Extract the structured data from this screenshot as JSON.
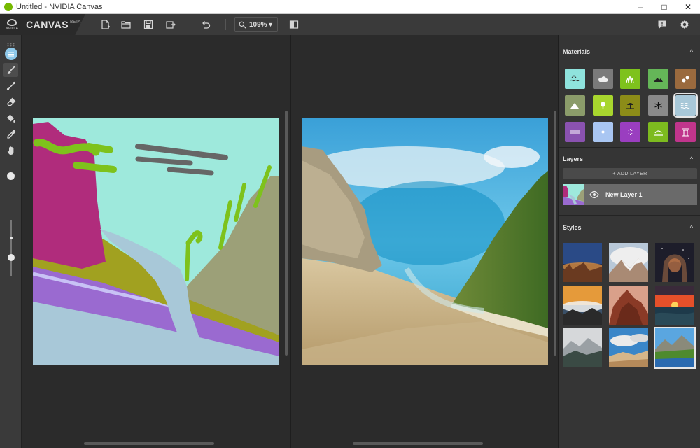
{
  "window": {
    "title": "Untitled - NVIDIA Canvas",
    "min_glyph": "–",
    "max_glyph": "□",
    "close_glyph": "✕"
  },
  "brand": {
    "logo_text": "NVIDIA",
    "name": "CANVAS",
    "badge": "BETA"
  },
  "toolbar": {
    "zoom_value": "109%",
    "zoom_caret": "▼",
    "icons": [
      "new-file-icon",
      "open-folder-icon",
      "save-icon",
      "export-icon",
      "undo-icon",
      "search-icon",
      "split-view-icon",
      "feedback-icon",
      "gear-icon"
    ]
  },
  "tools": [
    "palette-icon",
    "brush-icon",
    "line-icon",
    "eraser-icon",
    "fill-bucket-icon",
    "eyedropper-icon",
    "hand-icon"
  ],
  "brush_size_level": 0.3,
  "colors": {
    "accent": "#76b900",
    "panel_bg": "#353535",
    "toolbar_bg": "#3a3a3a",
    "workspace_bg": "#2b2b2b"
  },
  "panels": {
    "materials": {
      "title": "Materials",
      "chevron": "^",
      "items": [
        {
          "name": "sea",
          "color": "#8fe3dd",
          "selected": false
        },
        {
          "name": "cloud",
          "color": "#7a7a7a",
          "selected": false
        },
        {
          "name": "grass",
          "color": "#7ec21c",
          "selected": false
        },
        {
          "name": "hill",
          "color": "#65b658",
          "selected": false
        },
        {
          "name": "dirt",
          "color": "#9a6a3e",
          "selected": false
        },
        {
          "name": "mountain",
          "color": "#8b9c6a",
          "selected": false
        },
        {
          "name": "tree",
          "color": "#a8d62e",
          "selected": false
        },
        {
          "name": "bush",
          "color": "#8c8c18",
          "selected": false
        },
        {
          "name": "snow",
          "color": "#8a8a8a",
          "selected": false
        },
        {
          "name": "water",
          "color": "#a8c8d8",
          "selected": true
        },
        {
          "name": "rock",
          "color": "#8a52b0",
          "selected": false
        },
        {
          "name": "sky",
          "color": "#a9c6f2",
          "selected": false
        },
        {
          "name": "flower",
          "color": "#9a3ec0",
          "selected": false
        },
        {
          "name": "sand",
          "color": "#7dbb1f",
          "selected": false
        },
        {
          "name": "building",
          "color": "#c0358c",
          "selected": false
        }
      ]
    },
    "layers": {
      "title": "Layers",
      "chevron": "^",
      "add_label": "+ ADD LAYER",
      "items": [
        {
          "name": "New Layer 1"
        }
      ]
    },
    "styles": {
      "title": "Styles",
      "chevron": "^",
      "items": [
        "dusk-desert",
        "snowy-peaks",
        "night-arch",
        "sunset-clouds",
        "red-cliffs",
        "orange-sunset",
        "misty-forest",
        "coastal-sky",
        "alpine-lake"
      ],
      "selected_index": 8
    }
  }
}
